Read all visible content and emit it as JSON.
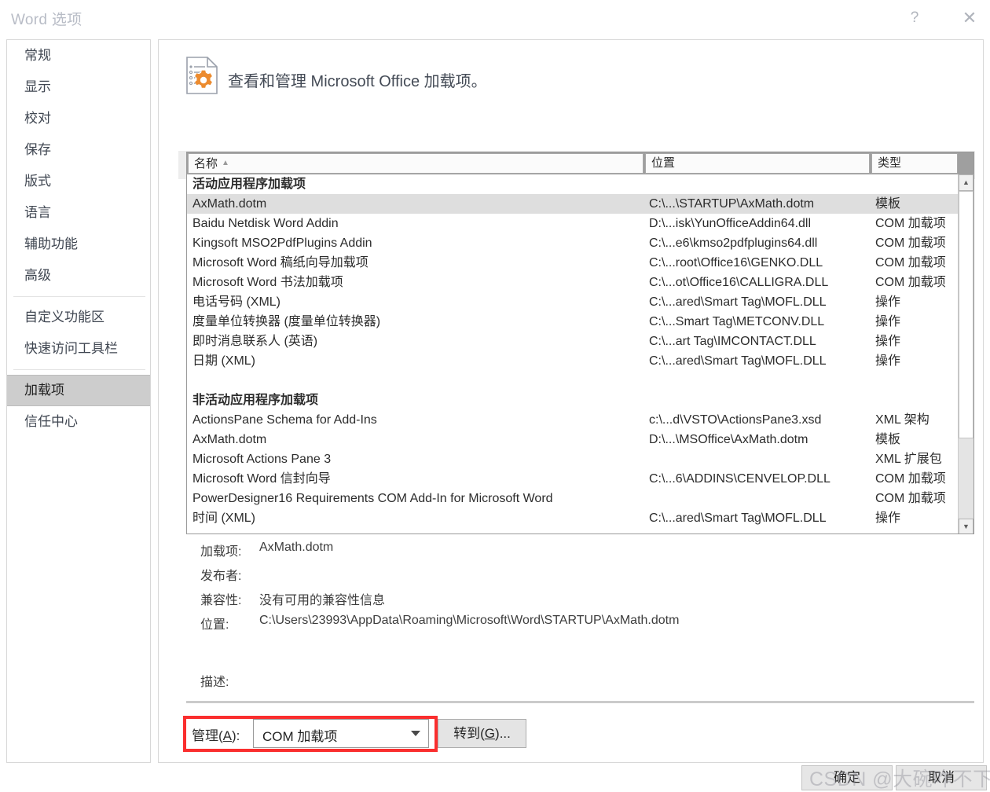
{
  "window": {
    "title": "Word 选项",
    "help_icon": "?",
    "close_icon": "✕"
  },
  "sidebar": {
    "items": [
      {
        "label": "常规",
        "selected": false
      },
      {
        "label": "显示",
        "selected": false
      },
      {
        "label": "校对",
        "selected": false
      },
      {
        "label": "保存",
        "selected": false
      },
      {
        "label": "版式",
        "selected": false
      },
      {
        "label": "语言",
        "selected": false
      },
      {
        "label": "辅助功能",
        "selected": false
      },
      {
        "label": "高级",
        "selected": false
      },
      {
        "separator": true
      },
      {
        "label": "自定义功能区",
        "selected": false
      },
      {
        "label": "快速访问工具栏",
        "selected": false
      },
      {
        "separator": true
      },
      {
        "label": "加载项",
        "selected": true
      },
      {
        "label": "信任中心",
        "selected": false
      }
    ]
  },
  "panel": {
    "header_text": "查看和管理 Microsoft Office 加载项。",
    "header_icon": "document-gear-icon",
    "section_label": "加载项"
  },
  "listview": {
    "columns": [
      {
        "label": "名称",
        "sort": "▲"
      },
      {
        "label": "位置",
        "sort": ""
      },
      {
        "label": "类型",
        "sort": ""
      }
    ],
    "rows": [
      {
        "kind": "group",
        "name": "活动应用程序加载项",
        "location": "",
        "type": ""
      },
      {
        "kind": "item",
        "name": "AxMath.dotm",
        "location": "C:\\...\\STARTUP\\AxMath.dotm",
        "type": "模板",
        "selected": true
      },
      {
        "kind": "item",
        "name": "Baidu Netdisk Word Addin",
        "location": "D:\\...isk\\YunOfficeAddin64.dll",
        "type": "COM 加载项"
      },
      {
        "kind": "item",
        "name": "Kingsoft MSO2PdfPlugins Addin",
        "location": "C:\\...e6\\kmso2pdfplugins64.dll",
        "type": "COM 加载项"
      },
      {
        "kind": "item",
        "name": "Microsoft Word 稿纸向导加载项",
        "location": "C:\\...root\\Office16\\GENKO.DLL",
        "type": "COM 加载项"
      },
      {
        "kind": "item",
        "name": "Microsoft Word 书法加载项",
        "location": "C:\\...ot\\Office16\\CALLIGRA.DLL",
        "type": "COM 加载项"
      },
      {
        "kind": "item",
        "name": "电话号码 (XML)",
        "location": "C:\\...ared\\Smart Tag\\MOFL.DLL",
        "type": "操作"
      },
      {
        "kind": "item",
        "name": "度量单位转换器 (度量单位转换器)",
        "location": "C:\\...Smart Tag\\METCONV.DLL",
        "type": "操作"
      },
      {
        "kind": "item",
        "name": "即时消息联系人 (英语)",
        "location": "C:\\...art Tag\\IMCONTACT.DLL",
        "type": "操作"
      },
      {
        "kind": "item",
        "name": "日期 (XML)",
        "location": "C:\\...ared\\Smart Tag\\MOFL.DLL",
        "type": "操作"
      },
      {
        "kind": "spacer",
        "name": "",
        "location": "",
        "type": ""
      },
      {
        "kind": "group",
        "name": "非活动应用程序加载项",
        "location": "",
        "type": ""
      },
      {
        "kind": "item",
        "name": "ActionsPane Schema for Add-Ins",
        "location": "c:\\...d\\VSTO\\ActionsPane3.xsd",
        "type": "XML 架构"
      },
      {
        "kind": "item",
        "name": "AxMath.dotm",
        "location": "D:\\...\\MSOffice\\AxMath.dotm",
        "type": "模板"
      },
      {
        "kind": "item",
        "name": "Microsoft Actions Pane 3",
        "location": "",
        "type": "XML 扩展包"
      },
      {
        "kind": "item",
        "name": "Microsoft Word 信封向导",
        "location": "C:\\...6\\ADDINS\\CENVELOP.DLL",
        "type": "COM 加载项"
      },
      {
        "kind": "item",
        "name": "PowerDesigner16 Requirements COM Add-In for Microsoft Word",
        "location": "",
        "type": "COM 加载项"
      },
      {
        "kind": "item",
        "name": "时间 (XML)",
        "location": "C:\\...ared\\Smart Tag\\MOFL.DLL",
        "type": "操作"
      }
    ],
    "scrollbar": {
      "up_arrow": "▲",
      "down_arrow": "▼"
    }
  },
  "detail": {
    "rows": [
      {
        "label": "加载项:",
        "value": "AxMath.dotm"
      },
      {
        "label": "发布者:",
        "value": ""
      },
      {
        "label": "兼容性:",
        "value": "没有可用的兼容性信息"
      },
      {
        "label": "位置:",
        "value": "C:\\Users\\23993\\AppData\\Roaming\\Microsoft\\Word\\STARTUP\\AxMath.dotm"
      }
    ],
    "description_label": "描述:",
    "description_value": ""
  },
  "manage": {
    "label_prefix": "管理(",
    "label_key": "A",
    "label_suffix": "):",
    "selected_value": "COM 加载项",
    "dropdown_icon": "chevron-down-icon",
    "highlight_color": "#fa2e2e",
    "goto_prefix": "转到(",
    "goto_key": "G",
    "goto_suffix": ")..."
  },
  "footer": {
    "ok_label": "确定",
    "cancel_label": "取消",
    "watermark": "CSDN @大碗咋不下"
  }
}
